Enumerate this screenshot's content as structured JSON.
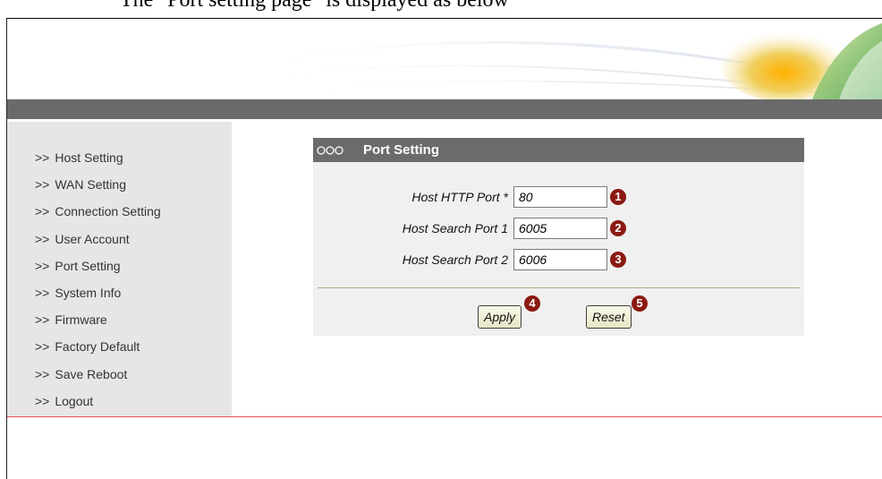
{
  "document": {
    "caption": "The \"Port setting page\" is displayed as below"
  },
  "sidebar": {
    "items": [
      {
        "arrow": ">>",
        "label": "Host Setting"
      },
      {
        "arrow": ">>",
        "label": "WAN Setting"
      },
      {
        "arrow": ">>",
        "label": "Connection Setting"
      },
      {
        "arrow": ">>",
        "label": "User Account"
      },
      {
        "arrow": ">>",
        "label": "Port Setting"
      },
      {
        "arrow": ">>",
        "label": "System Info"
      },
      {
        "arrow": ">>",
        "label": "Firmware"
      },
      {
        "arrow": ">>",
        "label": "Factory Default"
      },
      {
        "arrow": ">>",
        "label": "Save Reboot"
      },
      {
        "arrow": ">>",
        "label": "Logout"
      }
    ]
  },
  "panel": {
    "title": "Port Setting",
    "icon": "link-chain-icon",
    "fields": [
      {
        "label": "Host HTTP Port *",
        "value": "80",
        "badge": "1"
      },
      {
        "label": "Host Search Port 1",
        "value": "6005",
        "badge": "2"
      },
      {
        "label": "Host Search Port 2",
        "value": "6006",
        "badge": "3"
      }
    ],
    "buttons": {
      "apply": {
        "label": "Apply",
        "badge": "4"
      },
      "reset": {
        "label": "Reset",
        "badge": "5"
      }
    }
  },
  "colors": {
    "menu_bar": "#6a6a6a",
    "sidebar_bg": "#e6e6e6",
    "panel_header": "#6b6b6b",
    "badge": "#8b1a12",
    "separator_red": "#f05050"
  }
}
